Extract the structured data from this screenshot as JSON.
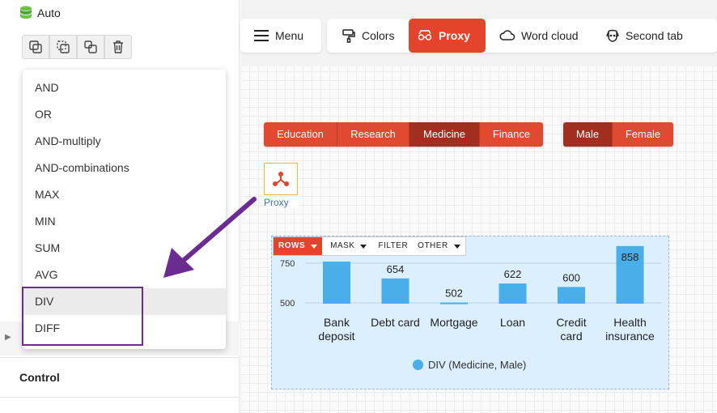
{
  "sidebar": {
    "auto_label": "Auto",
    "control_label": "Control",
    "tools": [
      "copy-icon",
      "copy-dashed-icon",
      "duplicate-icon",
      "trash-icon"
    ]
  },
  "dropdown": {
    "items": [
      "AND",
      "OR",
      "AND-multiply",
      "AND-combinations",
      "MAX",
      "MIN",
      "SUM",
      "AVG",
      "DIV",
      "DIFF"
    ],
    "active": "DIV"
  },
  "toolbar": {
    "menu": "Menu",
    "colors": "Colors",
    "proxy": "Proxy",
    "word_cloud": "Word cloud",
    "second_tab": "Second tab"
  },
  "filters": {
    "field": [
      "Education",
      "Research",
      "Medicine",
      "Finance"
    ],
    "gender": [
      "Male",
      "Female"
    ],
    "selected_field": "Medicine",
    "selected_gender": "Male"
  },
  "node": {
    "label": "Proxy"
  },
  "chart_toolbar": {
    "rows": "ROWS",
    "mask": "MASK",
    "filter": "FILTER",
    "other": "OTHER"
  },
  "colors": {
    "accent": "#e3442b",
    "accent_dark": "#a22e1f",
    "bar": "#4aaee8",
    "highlight": "#6a2c91"
  },
  "chart_data": {
    "type": "bar",
    "categories": [
      "Bank deposit",
      "Debt card",
      "Mortgage",
      "Loan",
      "Credit card",
      "Health insurance"
    ],
    "values": [
      760,
      654,
      502,
      622,
      600,
      858
    ],
    "value_labels": [
      "",
      "654",
      "502",
      "622",
      "600",
      "858"
    ],
    "y_ticks": [
      500,
      750
    ],
    "series": [
      {
        "name": "DIV (Medicine, Male)",
        "values": [
          760,
          654,
          502,
          622,
          600,
          858
        ]
      }
    ]
  }
}
